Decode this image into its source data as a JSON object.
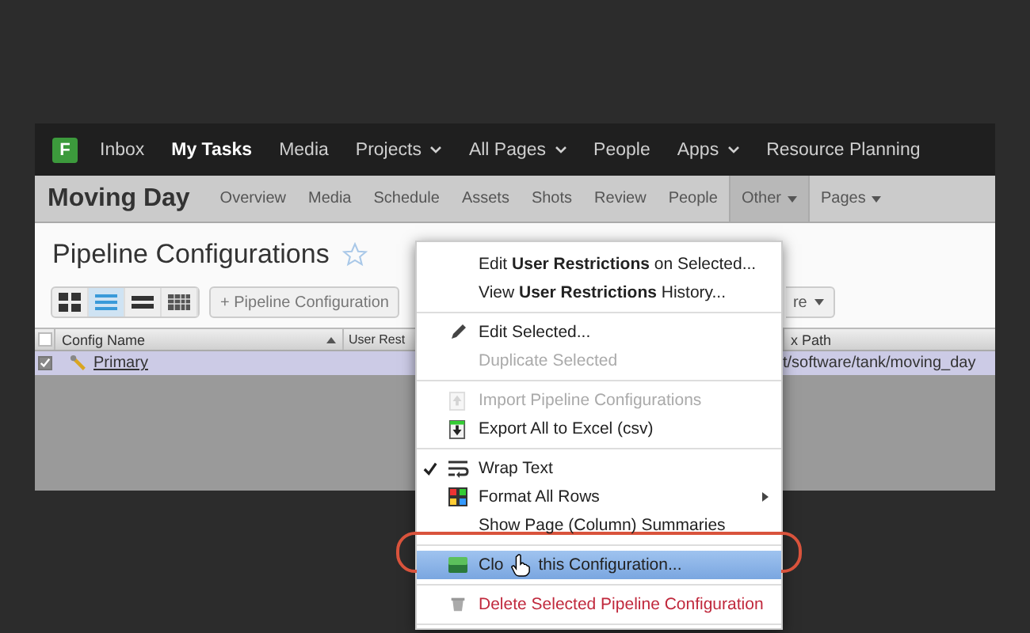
{
  "nav": {
    "items": [
      {
        "label": "Inbox",
        "selected": false,
        "dropdown": false
      },
      {
        "label": "My Tasks",
        "selected": true,
        "dropdown": false
      },
      {
        "label": "Media",
        "selected": false,
        "dropdown": false
      },
      {
        "label": "Projects",
        "selected": false,
        "dropdown": true
      },
      {
        "label": "All Pages",
        "selected": false,
        "dropdown": true
      },
      {
        "label": "People",
        "selected": false,
        "dropdown": false
      },
      {
        "label": "Apps",
        "selected": false,
        "dropdown": true
      },
      {
        "label": "Resource Planning",
        "selected": false,
        "dropdown": false
      }
    ],
    "logo": "F"
  },
  "project_bar": {
    "title": "Moving Day",
    "items": [
      {
        "label": "Overview",
        "selected": false,
        "dropdown": false
      },
      {
        "label": "Media",
        "selected": false,
        "dropdown": false
      },
      {
        "label": "Schedule",
        "selected": false,
        "dropdown": false
      },
      {
        "label": "Assets",
        "selected": false,
        "dropdown": false
      },
      {
        "label": "Shots",
        "selected": false,
        "dropdown": false
      },
      {
        "label": "Review",
        "selected": false,
        "dropdown": false
      },
      {
        "label": "People",
        "selected": false,
        "dropdown": false
      },
      {
        "label": "Other",
        "selected": true,
        "dropdown": true
      },
      {
        "label": "Pages",
        "selected": false,
        "dropdown": true
      }
    ]
  },
  "page": {
    "title": "Pipeline Configurations",
    "favorite": false
  },
  "toolbar": {
    "views": [
      {
        "kind": "thumbnails",
        "selected": false
      },
      {
        "kind": "list",
        "selected": true
      },
      {
        "kind": "rows",
        "selected": false
      },
      {
        "kind": "grid",
        "selected": false
      }
    ],
    "add_button": "+ Pipeline Configuration",
    "more_button": "re"
  },
  "table": {
    "all_checked": false,
    "columns": [
      "Config Name",
      "User Rest",
      "x Path"
    ],
    "rows": [
      {
        "checked": true,
        "name": "Primary",
        "path": "t/software/tank/moving_day"
      }
    ]
  },
  "menu": {
    "sections": [
      [
        {
          "kind": "none",
          "label": "Edit **User Restrictions** on Selected...",
          "disabled": false,
          "checked": false,
          "submenu": false,
          "selected": false,
          "danger": false
        },
        {
          "kind": "none",
          "label": "View **User Restrictions** History...",
          "disabled": false,
          "checked": false,
          "submenu": false,
          "selected": false,
          "danger": false
        }
      ],
      [
        {
          "kind": "pencil",
          "label": "Edit Selected...",
          "disabled": false,
          "checked": false,
          "submenu": false,
          "selected": false,
          "danger": false
        },
        {
          "kind": "none",
          "label": "Duplicate Selected",
          "disabled": true,
          "checked": false,
          "submenu": false,
          "selected": false,
          "danger": false
        }
      ],
      [
        {
          "kind": "import",
          "label": "Import Pipeline Configurations",
          "disabled": true,
          "checked": false,
          "submenu": false,
          "selected": false,
          "danger": false
        },
        {
          "kind": "export",
          "label": "Export All to Excel (csv)",
          "disabled": false,
          "checked": false,
          "submenu": false,
          "selected": false,
          "danger": false
        }
      ],
      [
        {
          "kind": "wrap",
          "label": "Wrap Text",
          "disabled": false,
          "checked": true,
          "submenu": false,
          "selected": false,
          "danger": false
        },
        {
          "kind": "format",
          "label": "Format All Rows",
          "disabled": false,
          "checked": false,
          "submenu": true,
          "selected": false,
          "danger": false
        },
        {
          "kind": "none",
          "label": "Show Page (Column) Summaries",
          "disabled": false,
          "checked": false,
          "submenu": false,
          "selected": false,
          "danger": false
        }
      ],
      [
        {
          "kind": "clone",
          "label": "Clo",
          "label_after_cursor": "this Configuration...",
          "disabled": false,
          "checked": false,
          "submenu": false,
          "selected": true,
          "danger": false
        }
      ],
      [
        {
          "kind": "trash",
          "label": "Delete Selected Pipeline Configuration",
          "disabled": false,
          "checked": false,
          "submenu": false,
          "selected": false,
          "danger": true
        }
      ]
    ]
  }
}
